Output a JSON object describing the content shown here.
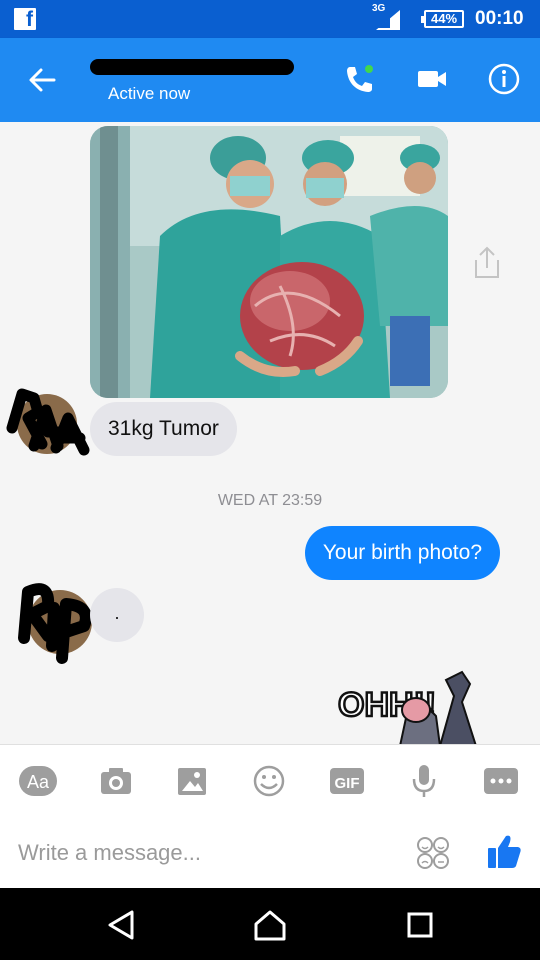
{
  "status_bar": {
    "network": "3G",
    "battery": "44%",
    "time": "00:10"
  },
  "header": {
    "status": "Active now"
  },
  "messages": {
    "image_caption": "31kg Tumor",
    "timestamp": "WED AT 23:59",
    "outgoing": "Your birth photo?",
    "reply": "."
  },
  "sticker": {
    "text": "OHH!!"
  },
  "avatars": {
    "first_scribble": "RIA",
    "second_scribble": "RIP"
  },
  "toolbar": {
    "text_button": "Aa",
    "gif_button": "GIF"
  },
  "composer": {
    "placeholder": "Write a message..."
  },
  "colors": {
    "status_bar": "#0a5fd0",
    "header": "#1f8af2",
    "outgoing_bubble": "#0f84ff",
    "incoming_bubble": "#e5e5ea",
    "icon": "#9e9e9e",
    "like": "#1877f2"
  },
  "icons": [
    "facebook-icon",
    "signal-icon",
    "back-arrow-icon",
    "phone-icon",
    "video-icon",
    "info-icon",
    "share-icon",
    "camera-icon",
    "image-icon",
    "smiley-icon",
    "gif-icon",
    "microphone-icon",
    "more-icon",
    "emoji-set-icon",
    "thumbs-up-icon",
    "nav-back-icon",
    "nav-home-icon",
    "nav-recents-icon"
  ]
}
